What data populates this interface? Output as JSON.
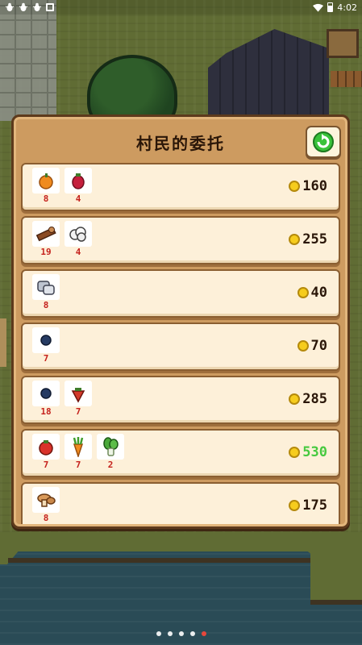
{
  "status_bar": {
    "time": "4:02",
    "left_icons": [
      "bug-icon",
      "bug-icon",
      "bug-icon",
      "square-icon"
    ],
    "right_icons": [
      "wifi-icon",
      "battery-icon"
    ]
  },
  "panel": {
    "title": "村民的委托",
    "refresh_icon": "refresh-icon",
    "refresh_color": "#39c23a"
  },
  "commissions": [
    {
      "items": [
        {
          "icon": "orange-fruit-icon",
          "count": "8"
        },
        {
          "icon": "red-berry-icon",
          "count": "4"
        }
      ],
      "reward": "160",
      "bonus": false
    },
    {
      "items": [
        {
          "icon": "wood-log-icon",
          "count": "19"
        },
        {
          "icon": "cotton-icon",
          "count": "4"
        }
      ],
      "reward": "255",
      "bonus": false
    },
    {
      "items": [
        {
          "icon": "stone-icon",
          "count": "8"
        }
      ],
      "reward": "40",
      "bonus": false
    },
    {
      "items": [
        {
          "icon": "blueberry-icon",
          "count": "7"
        }
      ],
      "reward": "70",
      "bonus": false
    },
    {
      "items": [
        {
          "icon": "blueberry-icon",
          "count": "18"
        },
        {
          "icon": "strawberry-icon",
          "count": "7"
        }
      ],
      "reward": "285",
      "bonus": false
    },
    {
      "items": [
        {
          "icon": "tomato-icon",
          "count": "7"
        },
        {
          "icon": "carrot-icon",
          "count": "7"
        },
        {
          "icon": "bok-choy-icon",
          "count": "2"
        }
      ],
      "reward": "530",
      "bonus": true
    },
    {
      "items": [
        {
          "icon": "mushroom-icon",
          "count": "8"
        }
      ],
      "reward": "175",
      "bonus": false
    }
  ],
  "colors": {
    "panel_bg": "#cd9b60",
    "row_bg": "#fdf0d9",
    "count_red": "#c5221d",
    "bonus_green": "#46c93f",
    "coin": "#f6cc1d"
  },
  "pager": {
    "count": 5,
    "active_index": 4
  }
}
